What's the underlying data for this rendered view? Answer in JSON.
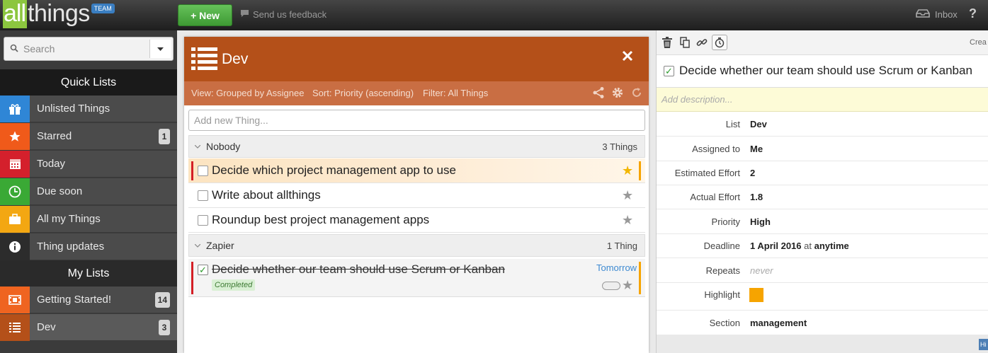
{
  "app": {
    "logo_prefix": "all",
    "logo_suffix": "things",
    "logo_tag": "TEAM",
    "new_button": "+ New",
    "feedback": "Send us feedback",
    "inbox": "Inbox",
    "help": "?"
  },
  "sidebar": {
    "search_placeholder": "Search",
    "quick_lists_heading": "Quick Lists",
    "quick_lists": [
      {
        "label": "Unlisted Things",
        "icon": "gift-icon",
        "color": "#2f86d6",
        "badge": ""
      },
      {
        "label": "Starred",
        "icon": "star-icon",
        "color": "#f05a1a",
        "badge": "1"
      },
      {
        "label": "Today",
        "icon": "calendar-icon",
        "color": "#d4202c",
        "badge": ""
      },
      {
        "label": "Due soon",
        "icon": "clock-icon",
        "color": "#3aa935",
        "badge": ""
      },
      {
        "label": "All my Things",
        "icon": "briefcase-icon",
        "color": "#f3a712",
        "badge": ""
      },
      {
        "label": "Thing updates",
        "icon": "info-icon",
        "color": "#2c2c2c",
        "badge": ""
      }
    ],
    "my_lists_heading": "My Lists",
    "my_lists": [
      {
        "label": "Getting Started!",
        "icon": "film-icon",
        "color": "#ef6420",
        "badge": "14"
      },
      {
        "label": "Dev",
        "icon": "list-icon",
        "color": "#b45019",
        "badge": "3"
      }
    ]
  },
  "list": {
    "title": "Dev",
    "view": "View: Grouped by Assignee",
    "sort": "Sort: Priority (ascending)",
    "filter": "Filter: All Things",
    "add_placeholder": "Add new Thing...",
    "groups": [
      {
        "name": "Nobody",
        "count": "3 Things",
        "things": [
          {
            "text": "Decide which project management app to use",
            "starred": true
          },
          {
            "text": "Write about allthings",
            "starred": false
          },
          {
            "text": "Roundup best project management apps",
            "starred": false
          }
        ]
      },
      {
        "name": "Zapier",
        "count": "1 Thing",
        "things": [
          {
            "text": "Decide whether our team should use Scrum or Kanban",
            "status": "Completed",
            "due": "Tomorrow",
            "starred": false
          }
        ]
      }
    ]
  },
  "detail": {
    "created_label": "Crea",
    "title": "Decide whether our team should use Scrum or Kanban",
    "description_placeholder": "Add description...",
    "props": {
      "list": {
        "label": "List",
        "value": "Dev"
      },
      "assigned": {
        "label": "Assigned to",
        "value": "Me"
      },
      "estimated": {
        "label": "Estimated Effort",
        "value": "2"
      },
      "actual": {
        "label": "Actual Effort",
        "value": "1.8"
      },
      "priority": {
        "label": "Priority",
        "value": "High"
      },
      "deadline": {
        "label": "Deadline",
        "date": "1 April 2016",
        "at": "at",
        "time": "anytime"
      },
      "repeats": {
        "label": "Repeats",
        "value": "never"
      },
      "highlight": {
        "label": "Highlight",
        "color": "#f6a400"
      },
      "section": {
        "label": "Section",
        "value": "management"
      }
    },
    "bottom_tag": "Hi"
  }
}
